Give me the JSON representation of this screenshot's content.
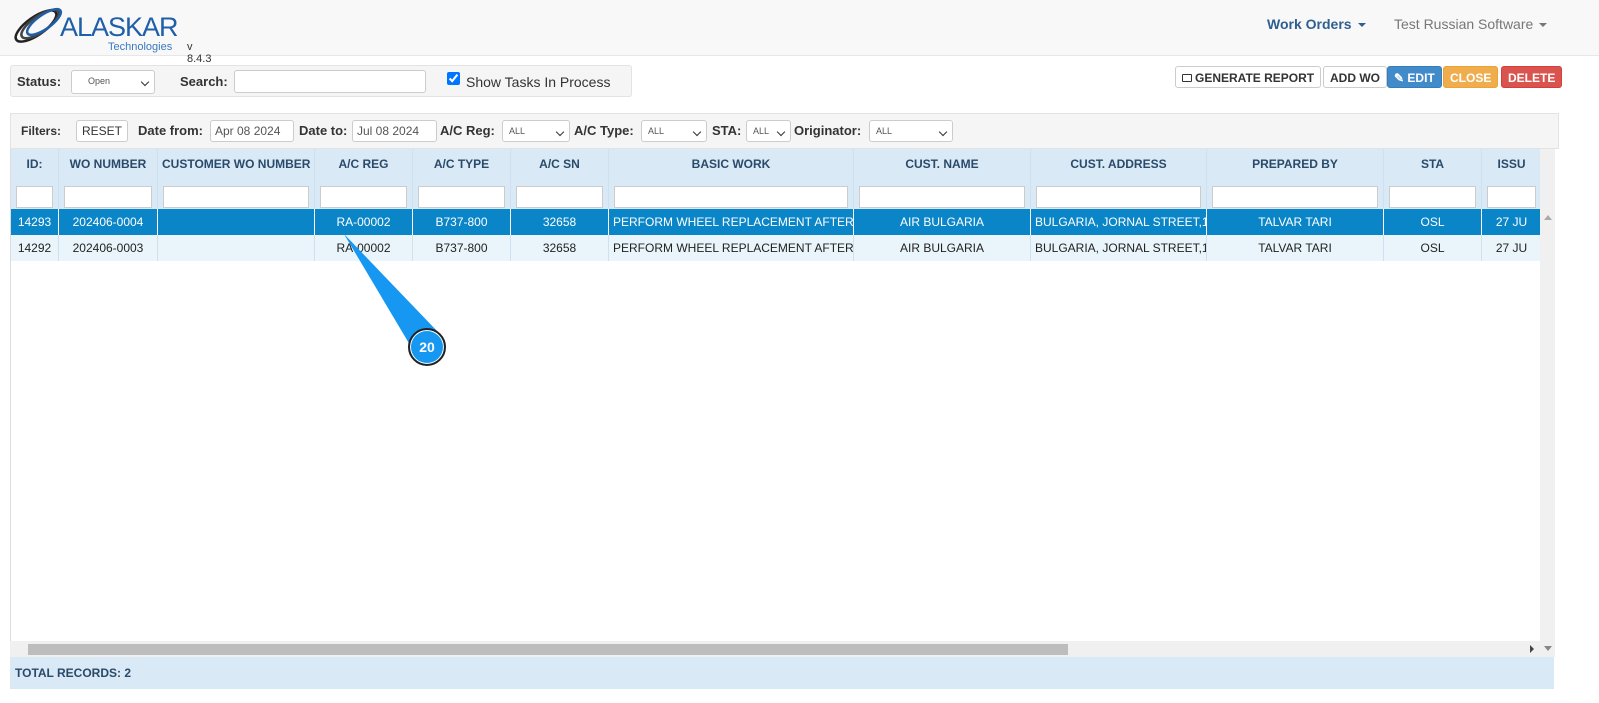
{
  "header": {
    "logo_text": "ALASKAR",
    "logo_sub": "Technologies",
    "version": "v 8.4.3",
    "nav": [
      {
        "label": "Work Orders"
      },
      {
        "label": "Test Russian Software"
      }
    ]
  },
  "toolbar": {
    "status_label": "Status:",
    "status_value": "Open",
    "search_label": "Search:",
    "search_value": "",
    "show_tasks_label": "Show Tasks In Process",
    "show_tasks_checked": true,
    "generate_report": "GENERATE REPORT",
    "add_wo": "ADD WO",
    "edit": "EDIT",
    "close": "CLOSE",
    "delete": "DELETE"
  },
  "filters": {
    "label": "Filters:",
    "reset": "RESET",
    "date_from_label": "Date from:",
    "date_from": "Apr 08 2024",
    "date_to_label": "Date to:",
    "date_to": "Jul 08 2024",
    "ac_reg_label": "A/C Reg:",
    "ac_reg": "ALL",
    "ac_type_label": "A/C Type:",
    "ac_type": "ALL",
    "sta_label": "STA:",
    "sta": "ALL",
    "originator_label": "Originator:",
    "originator": "ALL"
  },
  "table": {
    "columns": [
      "ID:",
      "WO NUMBER",
      "CUSTOMER WO NUMBER",
      "A/C REG",
      "A/C TYPE",
      "A/C SN",
      "BASIC WORK",
      "CUST. NAME",
      "CUST. ADDRESS",
      "PREPARED BY",
      "STA",
      "ISSU"
    ],
    "rows": [
      [
        "14293",
        "202406-0004",
        "",
        "RA-00002",
        "B737-800",
        "32658",
        "PERFORM WHEEL REPLACEMENT AFTER",
        "AIR BULGARIA",
        "BULGARIA, JORNAL STREET,1",
        "TALVAR TARI",
        "OSL",
        "27 JU"
      ],
      [
        "14292",
        "202406-0003",
        "",
        "RA-00002",
        "B737-800",
        "32658",
        "PERFORM WHEEL REPLACEMENT AFTER",
        "AIR BULGARIA",
        "BULGARIA, JORNAL STREET,1",
        "TALVAR TARI",
        "OSL",
        "27 JU"
      ]
    ],
    "selected_row": 0,
    "total_records": "TOTAL RECORDS: 2"
  },
  "callout": {
    "number": "20"
  },
  "colors": {
    "accent": "#0a86c8",
    "edit": "#428bca",
    "close": "#f0ad4e",
    "delete": "#d9534f",
    "callout": "#1597f2"
  }
}
